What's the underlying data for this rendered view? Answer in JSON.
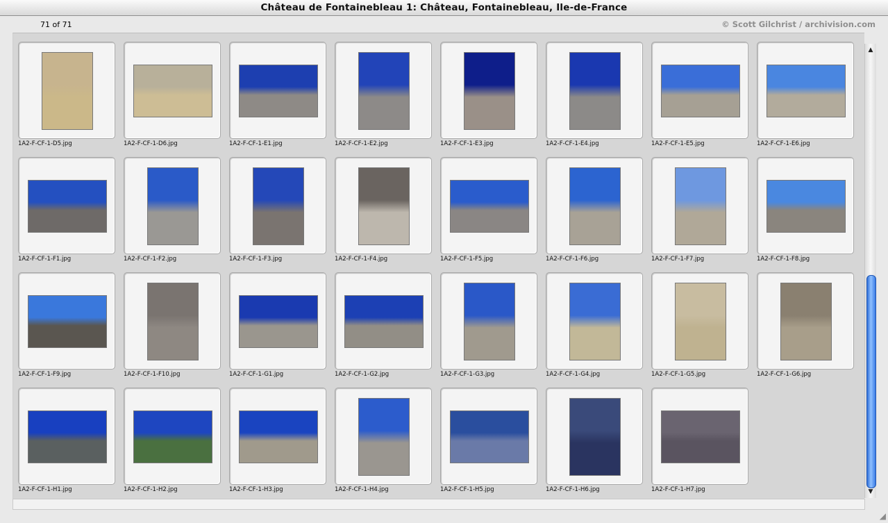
{
  "window": {
    "title": "Château de Fontainebleau 1: Château, Fontainebleau, Ile-de-France"
  },
  "info": {
    "count": "71 of 71",
    "credit": "© Scott Gilchrist / archivision.com"
  },
  "scrollbar": {
    "up_arrow": "▲",
    "down_arrow": "▼",
    "position_fraction": 1.0
  },
  "icons": {
    "resize": "resize-grip-icon"
  },
  "thumbnails": [
    {
      "filename": "1A2-F-CF-1-D5.jpg",
      "orientation": "portrait",
      "sky": "#c7b48e",
      "ground": "#cbb889"
    },
    {
      "filename": "1A2-F-CF-1-D6.jpg",
      "orientation": "landscape",
      "sky": "#b8b09a",
      "ground": "#cdbd95"
    },
    {
      "filename": "1A2-F-CF-1-E1.jpg",
      "orientation": "landscape",
      "sky": "#1d3fb0",
      "ground": "#8e8a86"
    },
    {
      "filename": "1A2-F-CF-1-E2.jpg",
      "orientation": "portrait",
      "sky": "#2244b8",
      "ground": "#8d8a88"
    },
    {
      "filename": "1A2-F-CF-1-E3.jpg",
      "orientation": "portrait",
      "sky": "#0e1e8a",
      "ground": "#9a9088"
    },
    {
      "filename": "1A2-F-CF-1-E4.jpg",
      "orientation": "portrait",
      "sky": "#1a38b0",
      "ground": "#8c8a88"
    },
    {
      "filename": "1A2-F-CF-1-E5.jpg",
      "orientation": "landscape",
      "sky": "#3a6ed8",
      "ground": "#a6a094"
    },
    {
      "filename": "1A2-F-CF-1-E6.jpg",
      "orientation": "landscape",
      "sky": "#4a86e0",
      "ground": "#b2ab9c"
    },
    {
      "filename": "1A2-F-CF-1-F1.jpg",
      "orientation": "landscape",
      "sky": "#2450c0",
      "ground": "#6e6a68"
    },
    {
      "filename": "1A2-F-CF-1-F2.jpg",
      "orientation": "portrait",
      "sky": "#2a5ac8",
      "ground": "#9a9894"
    },
    {
      "filename": "1A2-F-CF-1-F3.jpg",
      "orientation": "portrait",
      "sky": "#2448b8",
      "ground": "#7a7470"
    },
    {
      "filename": "1A2-F-CF-1-F4.jpg",
      "orientation": "portrait",
      "sky": "#6a6460",
      "ground": "#bdb7ad"
    },
    {
      "filename": "1A2-F-CF-1-F5.jpg",
      "orientation": "landscape",
      "sky": "#2a5ccc",
      "ground": "#8a8684"
    },
    {
      "filename": "1A2-F-CF-1-F6.jpg",
      "orientation": "portrait",
      "sky": "#2c64d0",
      "ground": "#a8a296"
    },
    {
      "filename": "1A2-F-CF-1-F7.jpg",
      "orientation": "portrait",
      "sky": "#6e98e0",
      "ground": "#b0a898"
    },
    {
      "filename": "1A2-F-CF-1-F8.jpg",
      "orientation": "landscape",
      "sky": "#4a88e0",
      "ground": "#8a857e"
    },
    {
      "filename": "1A2-F-CF-1-F9.jpg",
      "orientation": "landscape",
      "sky": "#3a78dc",
      "ground": "#5a5650"
    },
    {
      "filename": "1A2-F-CF-1-F10.jpg",
      "orientation": "portrait",
      "sky": "#7a7470",
      "ground": "#8e8882"
    },
    {
      "filename": "1A2-F-CF-1-G1.jpg",
      "orientation": "landscape",
      "sky": "#1a3ab0",
      "ground": "#9a968e"
    },
    {
      "filename": "1A2-F-CF-1-G2.jpg",
      "orientation": "landscape",
      "sky": "#1c40b4",
      "ground": "#928e86"
    },
    {
      "filename": "1A2-F-CF-1-G3.jpg",
      "orientation": "portrait",
      "sky": "#2a58c8",
      "ground": "#a09a8e"
    },
    {
      "filename": "1A2-F-CF-1-G4.jpg",
      "orientation": "portrait",
      "sky": "#3a6cd4",
      "ground": "#c2b898"
    },
    {
      "filename": "1A2-F-CF-1-G5.jpg",
      "orientation": "portrait",
      "sky": "#c8bca0",
      "ground": "#bfb290"
    },
    {
      "filename": "1A2-F-CF-1-G6.jpg",
      "orientation": "portrait",
      "sky": "#8a8070",
      "ground": "#a89e8a"
    },
    {
      "filename": "1A2-F-CF-1-H1.jpg",
      "orientation": "landscape",
      "sky": "#1840c0",
      "ground": "#5a6060"
    },
    {
      "filename": "1A2-F-CF-1-H2.jpg",
      "orientation": "landscape",
      "sky": "#1e46c0",
      "ground": "#4a7040"
    },
    {
      "filename": "1A2-F-CF-1-H3.jpg",
      "orientation": "landscape",
      "sky": "#1a44c0",
      "ground": "#a09a8c"
    },
    {
      "filename": "1A2-F-CF-1-H4.jpg",
      "orientation": "portrait",
      "sky": "#2c5ccc",
      "ground": "#9a9690"
    },
    {
      "filename": "1A2-F-CF-1-H5.jpg",
      "orientation": "landscape",
      "sky": "#2a4e9e",
      "ground": "#6a7aa8"
    },
    {
      "filename": "1A2-F-CF-1-H6.jpg",
      "orientation": "portrait",
      "sky": "#3a4a7a",
      "ground": "#2a3460"
    },
    {
      "filename": "1A2-F-CF-1-H7.jpg",
      "orientation": "landscape",
      "sky": "#6a6470",
      "ground": "#5a5460"
    }
  ]
}
